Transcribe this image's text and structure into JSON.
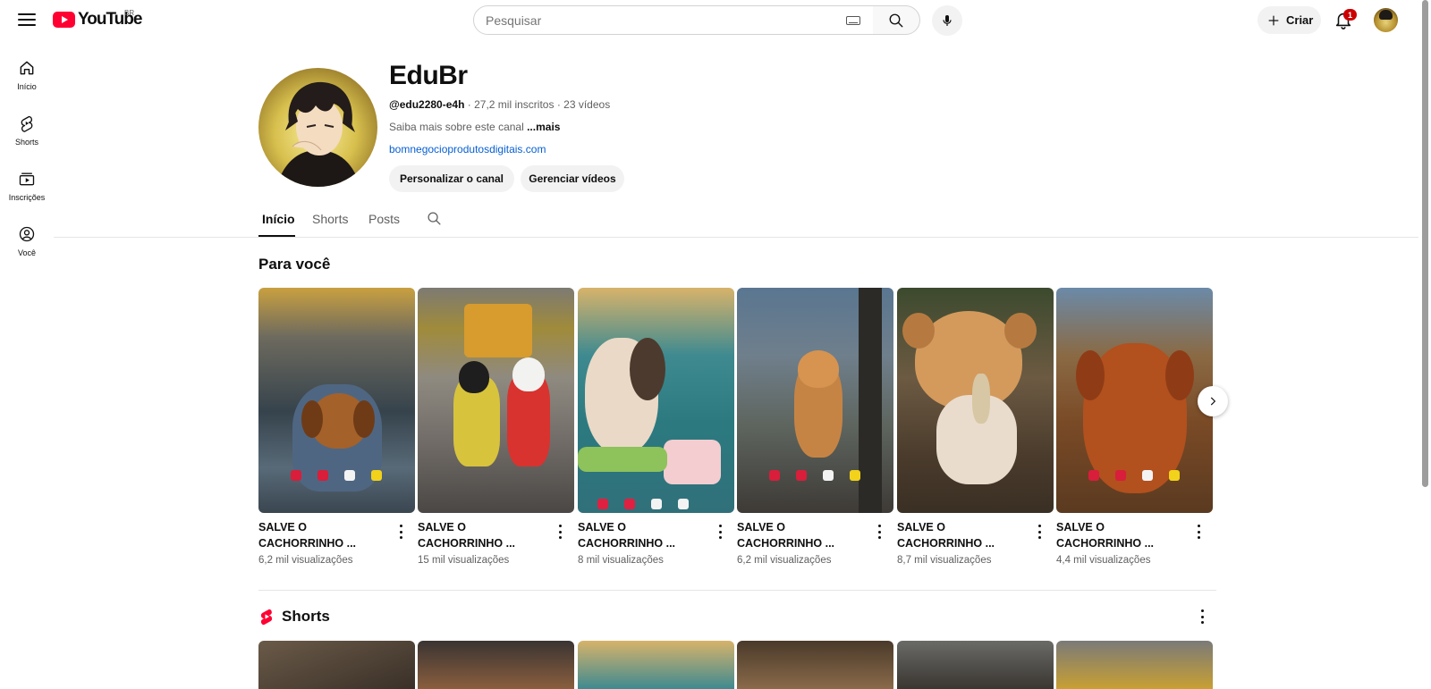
{
  "topbar": {
    "logo_text": "YouTube",
    "region": "BR",
    "search_placeholder": "Pesquisar",
    "create_label": "Criar",
    "notification_count": "1"
  },
  "sidebar": {
    "items": [
      {
        "label": "Início",
        "icon": "home-icon"
      },
      {
        "label": "Shorts",
        "icon": "shorts-icon"
      },
      {
        "label": "Inscrições",
        "icon": "subscriptions-icon"
      },
      {
        "label": "Você",
        "icon": "you-icon"
      }
    ]
  },
  "channel": {
    "name": "EduBr",
    "handle": "@edu2280-e4h",
    "subscribers": "27,2 mil inscritos",
    "videos": "23 vídeos",
    "description": "Saiba mais sobre este canal",
    "more_label": "...mais",
    "link": "bomnegocioprodutosdigitais.com",
    "customize_label": "Personalizar o canal",
    "manage_label": "Gerenciar vídeos"
  },
  "tabs": [
    {
      "label": "Início",
      "active": true
    },
    {
      "label": "Shorts",
      "active": false
    },
    {
      "label": "Posts",
      "active": false
    }
  ],
  "for_you": {
    "title": "Para você",
    "cards": [
      {
        "title": "SALVE O CACHORRINHO ...",
        "views": "6,2 mil visualizações"
      },
      {
        "title": "SALVE O CACHORRINHO ...",
        "views": "15 mil visualizações"
      },
      {
        "title": "SALVE O CACHORRINHO ...",
        "views": "8 mil visualizações"
      },
      {
        "title": "SALVE O CACHORRINHO ...",
        "views": "6,2 mil visualizações"
      },
      {
        "title": "SALVE O CACHORRINHO ...",
        "views": "8,7 mil visualizações"
      },
      {
        "title": "SALVE O CACHORRINHO ...",
        "views": "4,4 mil visualizações"
      }
    ]
  },
  "shorts_section": {
    "title": "Shorts"
  },
  "colors": {
    "brand_red": "#ff0033",
    "link_blue": "#065fd4",
    "badge_red": "#cc0000"
  }
}
